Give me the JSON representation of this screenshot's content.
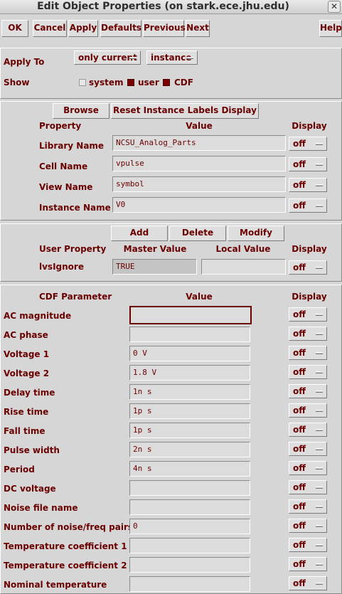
{
  "window": {
    "title": "Edit Object Properties (on stark.ece.jhu.edu)",
    "close_glyph": "✕"
  },
  "toolbar": {
    "ok": "OK",
    "cancel": "Cancel",
    "apply": "Apply",
    "defaults": "Defaults",
    "previous": "Previous",
    "next": "Next",
    "help": "Help"
  },
  "apply_to": {
    "label": "Apply To",
    "scope_value": "only current",
    "object_value": "instance"
  },
  "show": {
    "label": "Show",
    "options": [
      {
        "label": "system",
        "checked": false
      },
      {
        "label": "user",
        "checked": true
      },
      {
        "label": "CDF",
        "checked": true
      }
    ]
  },
  "instance_props": {
    "browse": "Browse",
    "reset": "Reset Instance Labels Display",
    "headers": {
      "property": "Property",
      "value": "Value",
      "display": "Display"
    },
    "rows": [
      {
        "name": "Library Name",
        "value": "NCSU_Analog_Parts",
        "display": "off"
      },
      {
        "name": "Cell Name",
        "value": "vpulse",
        "display": "off"
      },
      {
        "name": "View Name",
        "value": "symbol",
        "display": "off"
      },
      {
        "name": "Instance Name",
        "value": "V0",
        "display": "off"
      }
    ]
  },
  "user_props": {
    "add": "Add",
    "delete": "Delete",
    "modify": "Modify",
    "headers": {
      "user_property": "User Property",
      "master_value": "Master Value",
      "local_value": "Local Value",
      "display": "Display"
    },
    "rows": [
      {
        "name": "lvsIgnore",
        "master": "TRUE",
        "local": "",
        "display": "off"
      }
    ]
  },
  "cdf": {
    "headers": {
      "param": "CDF Parameter",
      "value": "Value",
      "display": "Display"
    },
    "rows": [
      {
        "name": "AC magnitude",
        "value": "",
        "display": "off"
      },
      {
        "name": "AC phase",
        "value": "",
        "display": "off"
      },
      {
        "name": "Voltage 1",
        "value": "0 V",
        "display": "off"
      },
      {
        "name": "Voltage 2",
        "value": "1.8 V",
        "display": "off"
      },
      {
        "name": "Delay time",
        "value": "1n s",
        "display": "off"
      },
      {
        "name": "Rise time",
        "value": "1p s",
        "display": "off"
      },
      {
        "name": "Fall time",
        "value": "1p s",
        "display": "off"
      },
      {
        "name": "Pulse width",
        "value": "2n s",
        "display": "off"
      },
      {
        "name": "Period",
        "value": "4n s",
        "display": "off"
      },
      {
        "name": "DC voltage",
        "value": "",
        "display": "off"
      },
      {
        "name": "Noise file name",
        "value": "",
        "display": "off"
      },
      {
        "name": "Number of noise/freq pairs",
        "value": "0",
        "display": "off"
      },
      {
        "name": "Temperature coefficient 1",
        "value": "",
        "display": "off"
      },
      {
        "name": "Temperature coefficient 2",
        "value": "",
        "display": "off"
      },
      {
        "name": "Nominal temperature",
        "value": "",
        "display": "off"
      }
    ]
  }
}
